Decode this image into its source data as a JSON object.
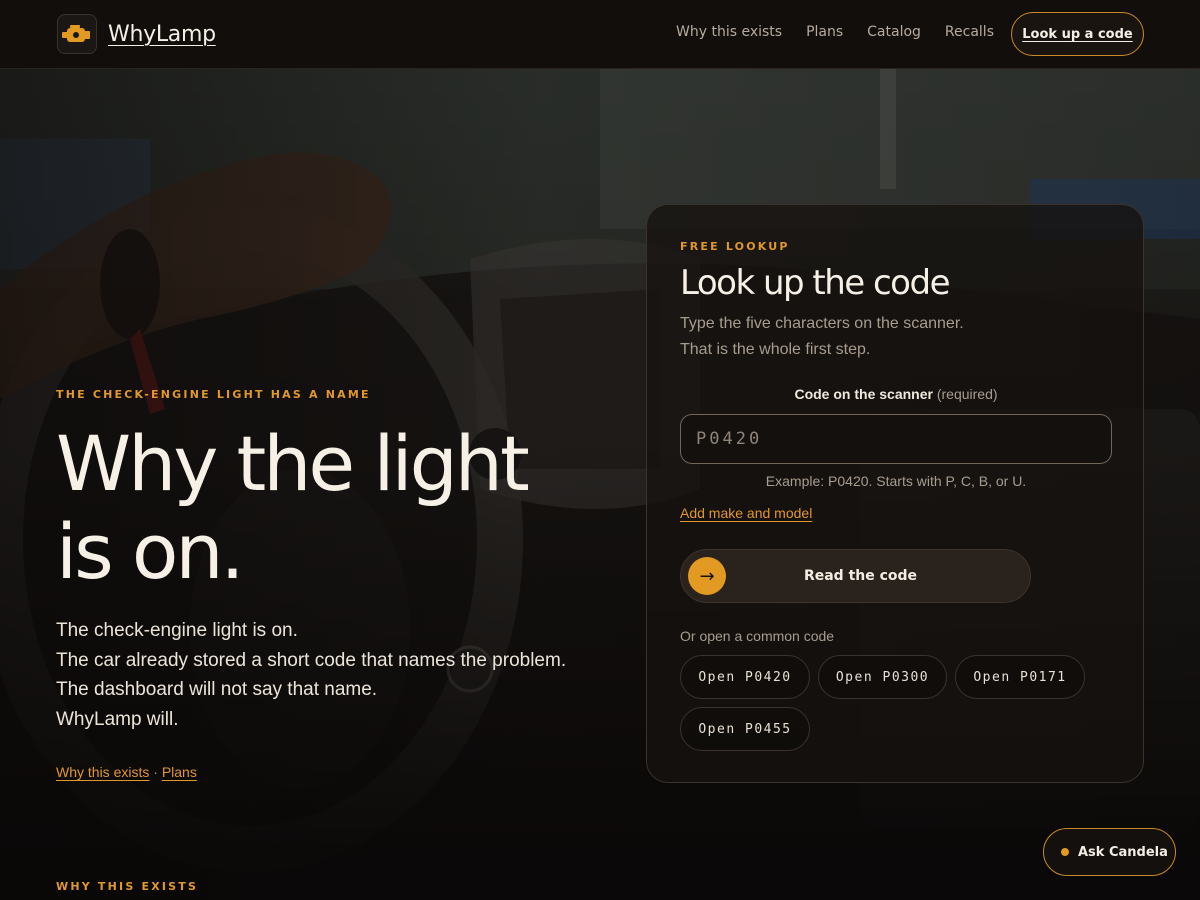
{
  "brand": {
    "name": "WhyLamp",
    "logo_icon": "engine-icon",
    "accent": "#e39a22"
  },
  "nav": {
    "items": [
      "Why this exists",
      "Plans",
      "Catalog",
      "Recalls"
    ],
    "cta": "Look up a code"
  },
  "hero": {
    "eyebrow": "THE CHECK-ENGINE LIGHT HAS A NAME",
    "title_line1": "Why the light",
    "title_line2": "is on.",
    "body": [
      "The check-engine light is on.",
      "The car already stored a short code that names the problem.",
      "The dashboard will not say that name.",
      "WhyLamp will."
    ],
    "links": [
      "Why this exists",
      "Plans"
    ],
    "link_separator": "·"
  },
  "lookup": {
    "eyebrow": "FREE LOOKUP",
    "title": "Look up the code",
    "subtitle": [
      "Type the five characters on the scanner.",
      "That is the whole first step."
    ],
    "field_label": "Code on the scanner",
    "field_required": "(required)",
    "placeholder": "P0420",
    "value": "",
    "helper": "Example: P0420. Starts with P, C, B, or U.",
    "add_link": "Add make and model",
    "submit_label": "Read the code",
    "submit_icon": "arrow-right-icon",
    "common_label": "Or open a common code",
    "common_codes": [
      "Open P0420",
      "Open P0300",
      "Open P0171",
      "Open P0455"
    ]
  },
  "next_section_eyebrow": "WHY THIS EXISTS",
  "assistant": {
    "label": "Ask Candela"
  }
}
